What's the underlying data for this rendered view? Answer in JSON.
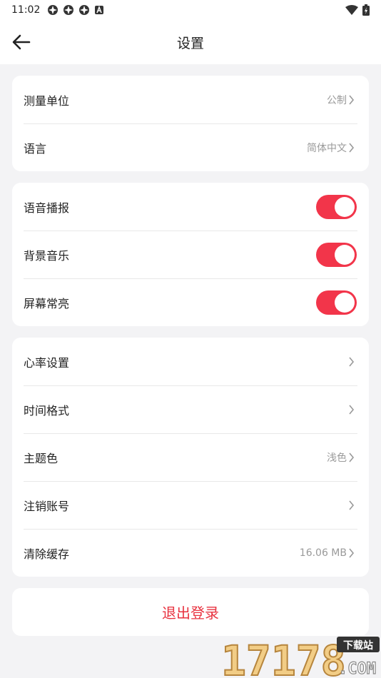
{
  "status_bar": {
    "time": "11:02"
  },
  "header": {
    "title": "设置"
  },
  "group1": [
    {
      "label": "测量单位",
      "value": "公制"
    },
    {
      "label": "语言",
      "value": "简体中文"
    }
  ],
  "group2": [
    {
      "label": "语音播报",
      "on": true
    },
    {
      "label": "背景音乐",
      "on": true
    },
    {
      "label": "屏幕常亮",
      "on": true
    }
  ],
  "group3": [
    {
      "label": "心率设置",
      "value": ""
    },
    {
      "label": "时间格式",
      "value": ""
    },
    {
      "label": "主题色",
      "value": "浅色"
    },
    {
      "label": "注销账号",
      "value": ""
    },
    {
      "label": "清除缓存",
      "value": "16.06 MB"
    }
  ],
  "logout": {
    "label": "退出登录"
  },
  "watermark": {
    "text": "17178 下载站 .COM"
  },
  "colors": {
    "accent": "#f2354a",
    "logout": "#e8323f",
    "background": "#f3f3f5"
  }
}
